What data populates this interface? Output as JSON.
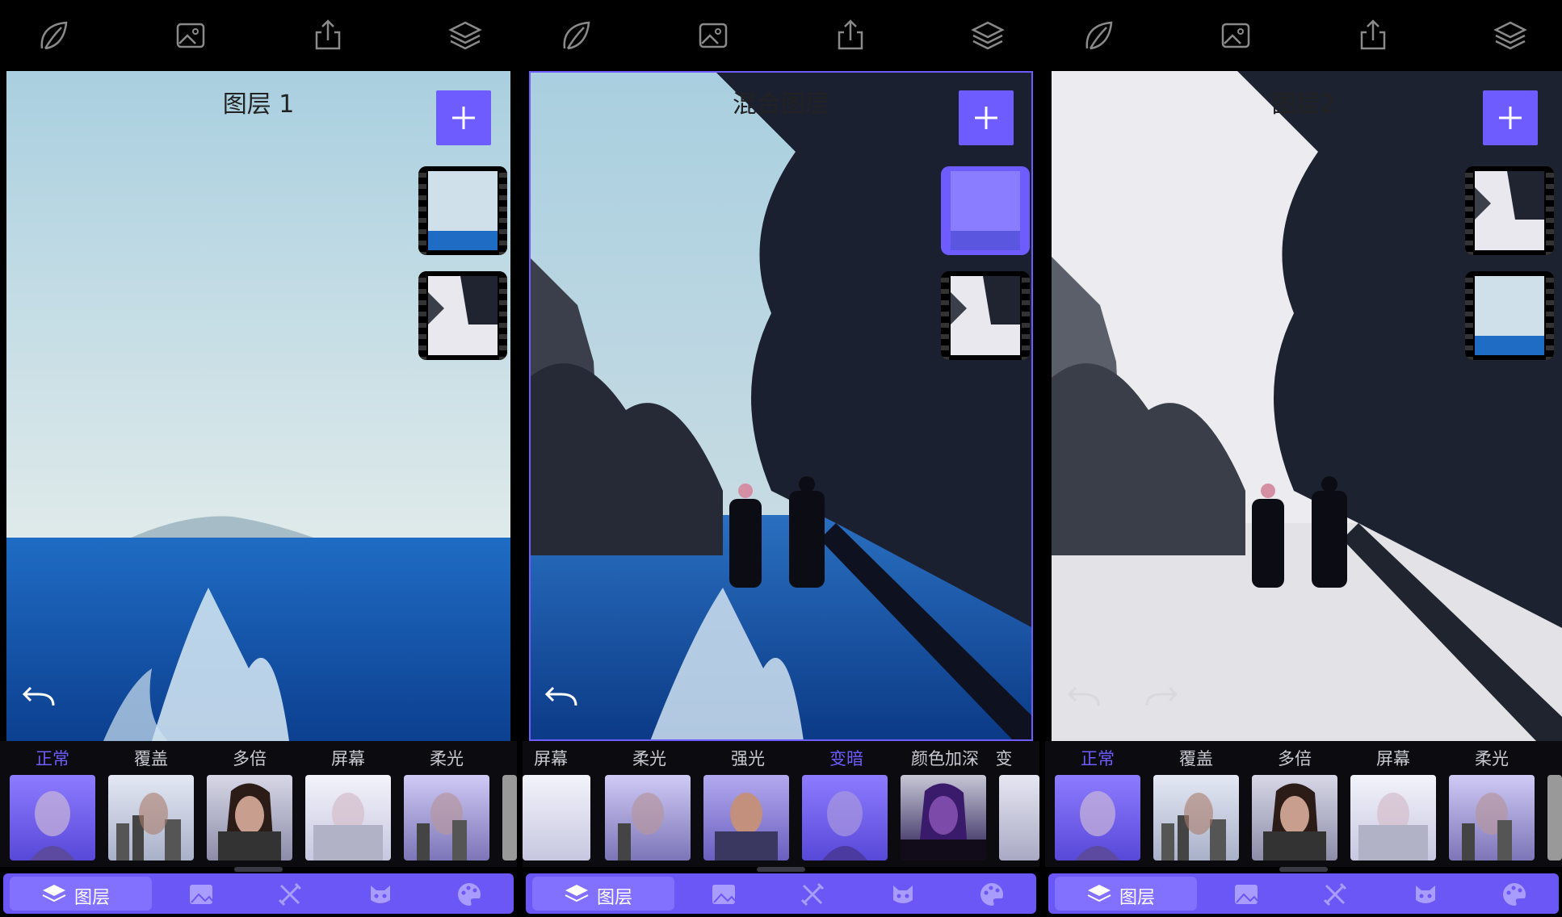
{
  "panels": [
    {
      "title": "图层 1",
      "modes": [
        "正常",
        "覆盖",
        "多倍",
        "屏幕",
        "柔光"
      ],
      "active_mode_index": 0,
      "active_filter_index": 0
    },
    {
      "title": "混合图层",
      "modes": [
        "屏幕",
        "柔光",
        "强光",
        "变暗",
        "颜色加深",
        "变"
      ],
      "active_mode_index": 3,
      "active_filter_index": 3
    },
    {
      "title": "图层2",
      "modes": [
        "正常",
        "覆盖",
        "多倍",
        "屏幕",
        "柔光"
      ],
      "active_mode_index": 0,
      "active_filter_index": 0
    }
  ],
  "top_icons": [
    "leaf-icon",
    "image-icon",
    "share-icon",
    "layers-icon"
  ],
  "bottom_tab_label": "图层",
  "bottom_icons": [
    "layers-icon",
    "image-icon",
    "tools-icon",
    "cat-mask-icon",
    "palette-icon"
  ],
  "colors": {
    "accent": "#6f5cff",
    "bar": "#6a57f5",
    "background": "#000000"
  }
}
